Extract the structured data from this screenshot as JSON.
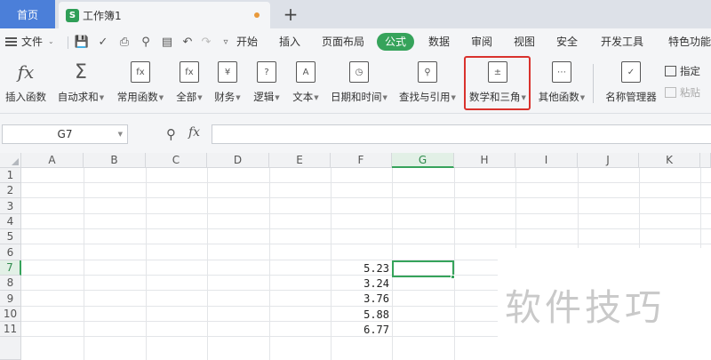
{
  "window": {
    "home_tab": "首页",
    "doc_tab": "工作簿1",
    "doc_icon_letter": "S",
    "new_tab_symbol": "+"
  },
  "menu": {
    "file_label": "文件",
    "tabs": [
      "开始",
      "插入",
      "页面布局",
      "公式",
      "数据",
      "审阅",
      "视图",
      "安全",
      "开发工具",
      "特色功能"
    ],
    "active_tab": "公式"
  },
  "ribbon": {
    "buttons": [
      {
        "label": "插入函数",
        "dropdown": false
      },
      {
        "label": "自动求和",
        "dropdown": true
      },
      {
        "label": "常用函数",
        "dropdown": true
      },
      {
        "label": "全部",
        "dropdown": true
      },
      {
        "label": "财务",
        "dropdown": true
      },
      {
        "label": "逻辑",
        "dropdown": true
      },
      {
        "label": "文本",
        "dropdown": true
      },
      {
        "label": "日期和时间",
        "dropdown": true
      },
      {
        "label": "查找与引用",
        "dropdown": true
      },
      {
        "label": "数学和三角",
        "dropdown": true
      },
      {
        "label": "其他函数",
        "dropdown": true
      },
      {
        "label": "名称管理器",
        "dropdown": false
      }
    ],
    "side_items": [
      "指定",
      "粘贴"
    ],
    "highlighted_button": "数学和三角"
  },
  "formula_bar": {
    "name_box": "G7",
    "fx_symbol": "fx",
    "formula": ""
  },
  "sheet": {
    "columns": [
      "A",
      "B",
      "C",
      "D",
      "E",
      "F",
      "G",
      "H",
      "I",
      "J",
      "K"
    ],
    "rows": [
      "1",
      "2",
      "3",
      "4",
      "5",
      "6",
      "7",
      "8",
      "9",
      "10",
      "11"
    ],
    "selected_column": "G",
    "selected_row": "7",
    "cells": [
      {
        "ref": "F7",
        "value": "5.23"
      },
      {
        "ref": "F8",
        "value": "3.24"
      },
      {
        "ref": "F9",
        "value": "3.76"
      },
      {
        "ref": "F10",
        "value": "5.88"
      },
      {
        "ref": "F11",
        "value": "6.77"
      }
    ]
  },
  "watermark": "软件技巧",
  "colors": {
    "accent_green": "#36a35b",
    "home_tab_blue": "#4b7fd9",
    "highlight_red": "#d9322d"
  }
}
